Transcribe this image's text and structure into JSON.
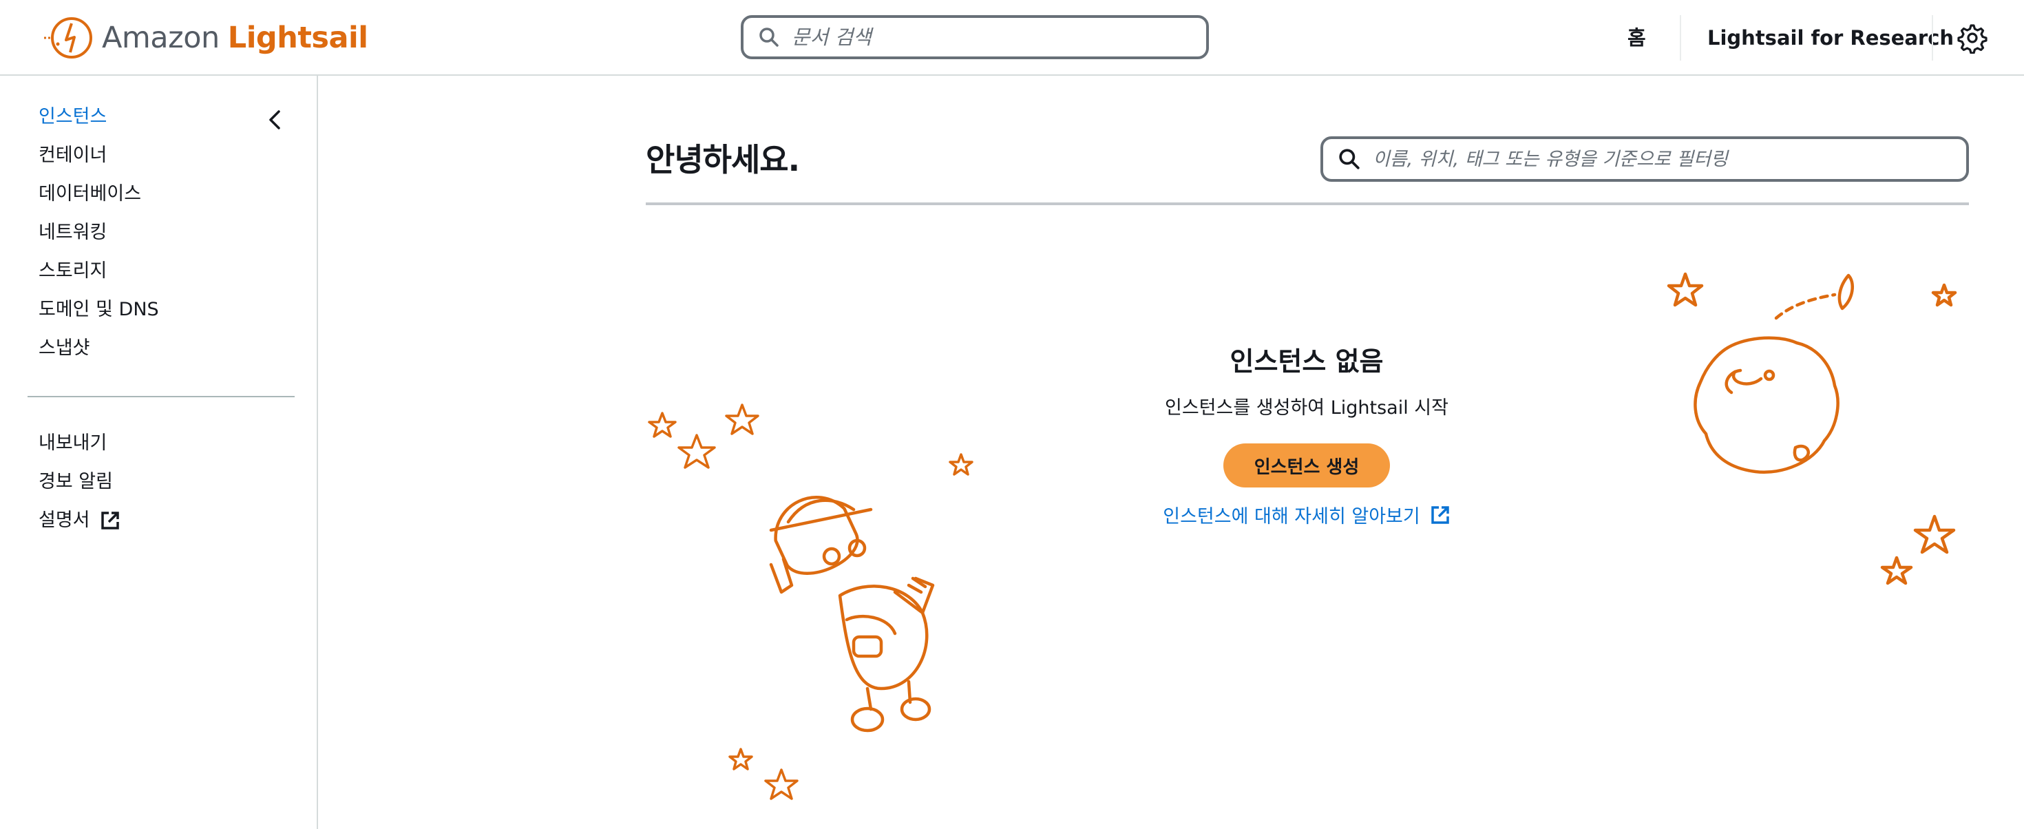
{
  "header": {
    "logo_amazon": "Amazon",
    "logo_light": "Lightsail",
    "doc_search_placeholder": "문서 검색",
    "nav_home": "홈",
    "nav_research": "Lightsail for Research"
  },
  "sidebar": {
    "items": [
      {
        "label": "인스턴스",
        "active": true
      },
      {
        "label": "컨테이너"
      },
      {
        "label": "데이터베이스"
      },
      {
        "label": "네트워킹"
      },
      {
        "label": "스토리지"
      },
      {
        "label": "도메인 및 DNS"
      },
      {
        "label": "스냅샷"
      }
    ],
    "secondary": [
      {
        "label": "내보내기"
      },
      {
        "label": "경보 알림"
      },
      {
        "label": "설명서"
      }
    ]
  },
  "main": {
    "title": "안녕하세요.",
    "filter_placeholder": "이름, 위치, 태그 또는 유형을 기준으로 필터링",
    "empty_title": "인스턴스 없음",
    "empty_desc": "인스턴스를 생성하여 Lightsail 시작",
    "create_button": "인스턴스 생성",
    "learn_link": "인스턴스에 대해 자세히 알아보기"
  },
  "colors": {
    "accent_orange": "#dd6b10",
    "button_orange": "#f59b3e",
    "link_blue": "#0972d3",
    "text": "#16191f"
  },
  "icons": [
    "lightsail-logo-icon",
    "search-icon",
    "gear-icon",
    "chevron-left-icon",
    "external-link-icon"
  ]
}
